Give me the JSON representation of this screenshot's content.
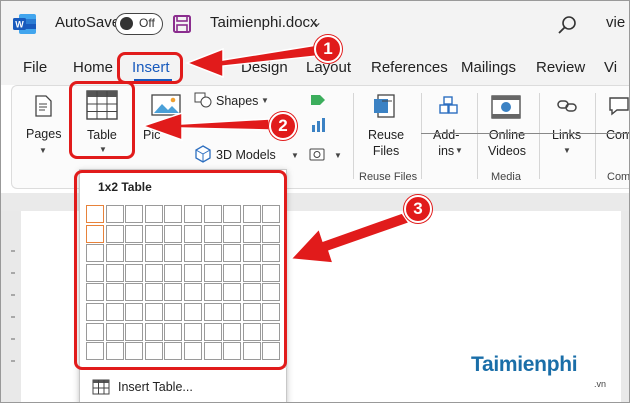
{
  "titlebar": {
    "autosave_label": "AutoSave",
    "autosave_state": "Off",
    "document_title": "Taimienphi.docx",
    "title_chevron": "⌄",
    "user_name_partial": "vie"
  },
  "tabs": [
    "File",
    "Home",
    "Insert",
    "Design",
    "Layout",
    "References",
    "Mailings",
    "Review",
    "Vi"
  ],
  "active_tab": "Insert",
  "ribbon": {
    "pages_label": "Pages",
    "table_label": "Table",
    "pictures_label_partial": "Pic",
    "shapes_label": "Shapes",
    "models_label": "3D Models",
    "reuse_files_label": "Reuse\nFiles",
    "reuse_files_group": "Reuse Files",
    "addins_label": "Add-\nins",
    "online_videos_label": "Online\nVideos",
    "media_group": "Media",
    "links_label": "Links",
    "comment_label_partial": "Com",
    "comments_group_partial": "Com"
  },
  "table_dropdown": {
    "title": "1x2 Table",
    "grid_columns": 10,
    "grid_rows": 8,
    "selected_columns": 1,
    "selected_rows": 2,
    "insert_table_label": "Insert Table..."
  },
  "callouts": [
    "1",
    "2",
    "3"
  ],
  "watermark": {
    "brand": "aimienphi",
    "brand_initial": "T",
    "tld": ".vn"
  },
  "colors": {
    "accent_blue": "#185abd",
    "callout_red": "#e11b1b",
    "selection_orange": "#e7823a"
  }
}
